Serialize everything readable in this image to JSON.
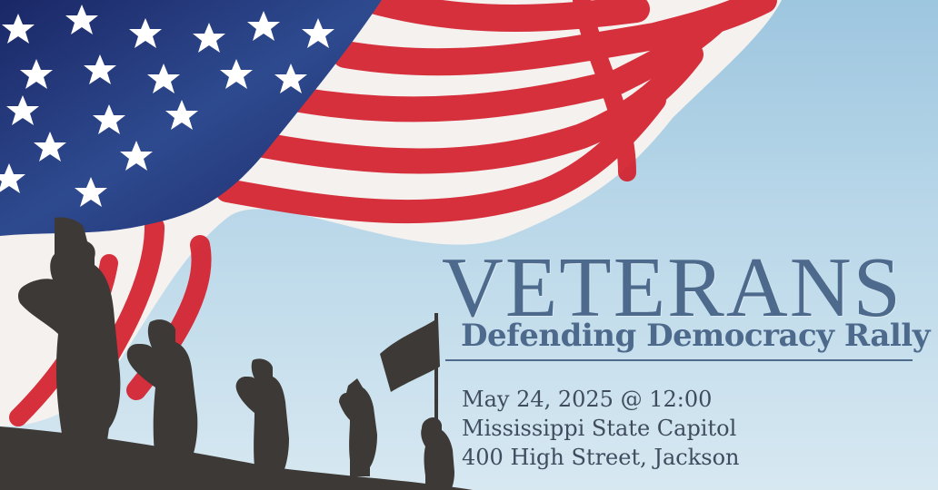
{
  "event": {
    "title": "VETERANS",
    "subtitle": "Defending Democracy Rally",
    "date_time": "May 24, 2025 @ 12:00",
    "venue": "Mississippi State Capitol",
    "address": "400 High Street, Jackson"
  },
  "colors": {
    "title": "#4d6a8c",
    "details": "#3f4c5e",
    "sky": "#b7d6e8",
    "flag_blue": "#1f2c68",
    "flag_red": "#d4202d",
    "silhouette": "#3d3936"
  },
  "images": {
    "flag": "american-flag-watercolor",
    "silhouettes": "saluting-soldiers-silhouettes"
  }
}
